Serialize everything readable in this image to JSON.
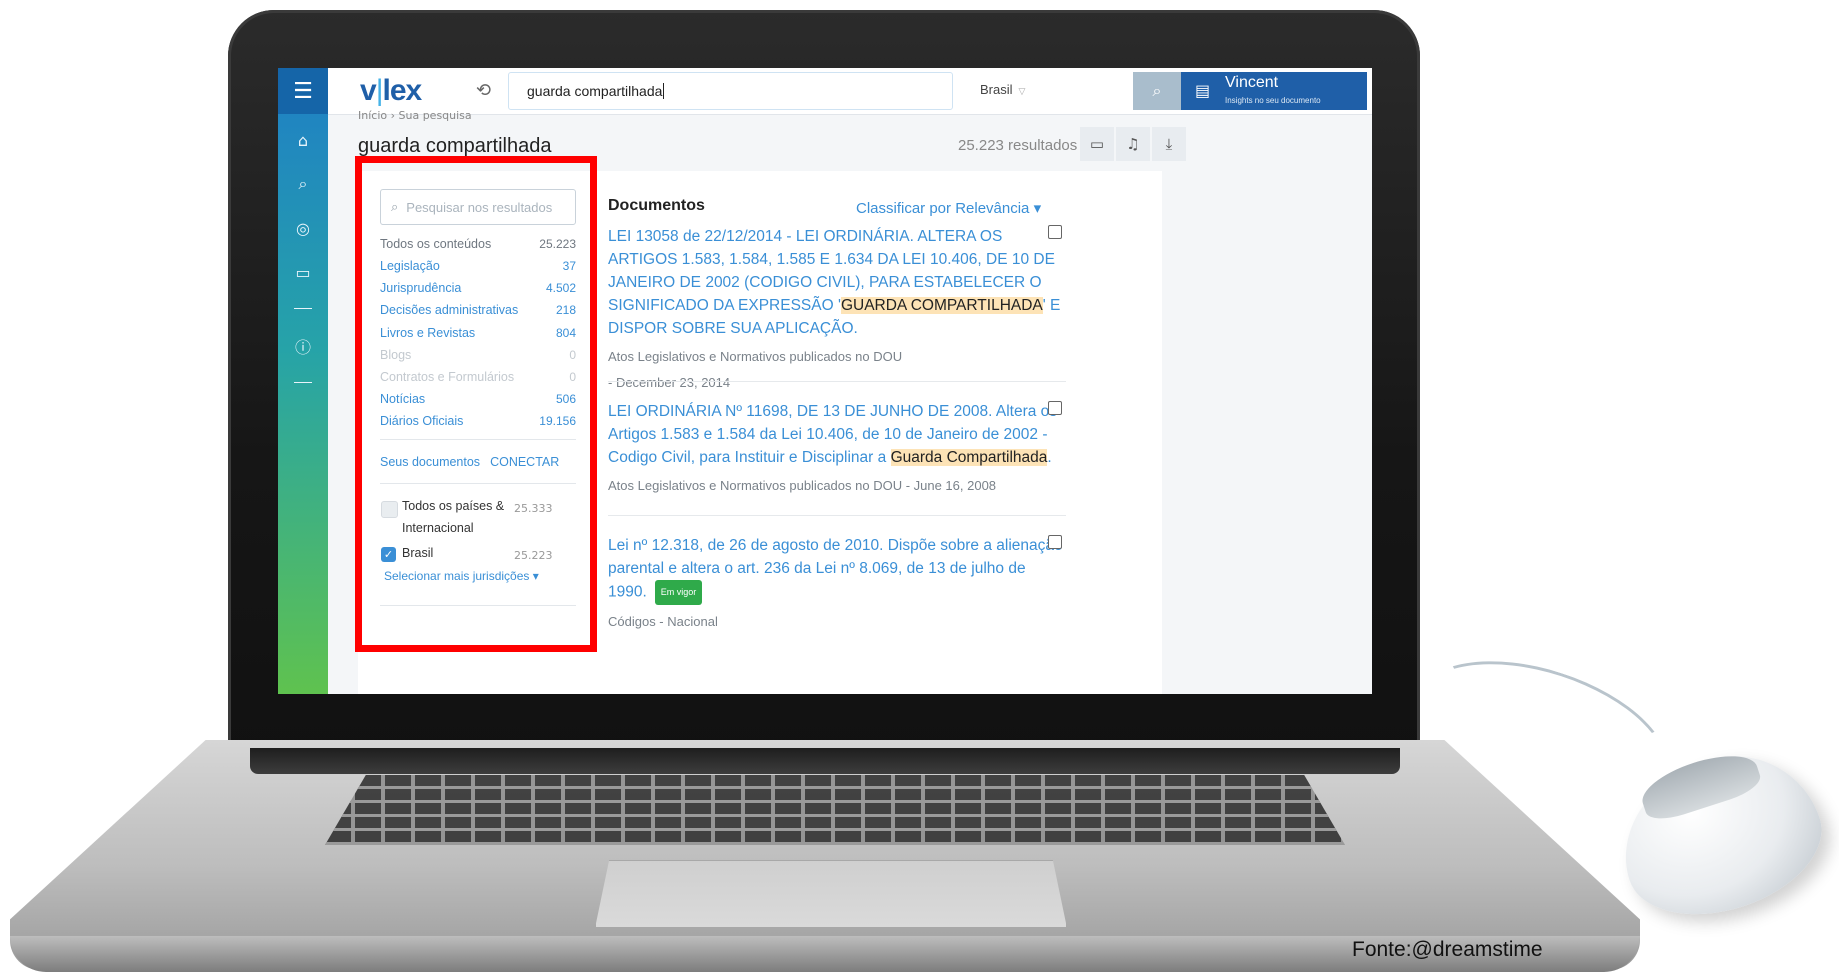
{
  "app": {
    "logo_left": "v",
    "logo_bar": "|",
    "logo_right": "lex",
    "search_query": "guarda compartilhada",
    "country": "Brasil",
    "user_name": "Vincent",
    "user_subtitle": "Insights no seu documento"
  },
  "sidebar": {
    "items": [
      {
        "name": "menu",
        "icon": "hamburger-icon",
        "glyph": "☰"
      },
      {
        "name": "home",
        "icon": "home-icon",
        "glyph": "⌂"
      },
      {
        "name": "search",
        "icon": "search-icon",
        "glyph": "⌕"
      },
      {
        "name": "explore",
        "icon": "compass-icon",
        "glyph": "◎"
      },
      {
        "name": "folders",
        "icon": "folder-icon",
        "glyph": "▭"
      },
      {
        "name": "info",
        "icon": "info-icon",
        "glyph": "ⓘ"
      }
    ]
  },
  "header": {
    "breadcrumb": "Início › Sua pesquisa",
    "page_title": "guarda compartilhada",
    "results_count": "25.223 resultados"
  },
  "filters": {
    "search_placeholder": "Pesquisar nos resultados",
    "all_label": "Todos os conteúdos",
    "all_count": "25.223",
    "categories": [
      {
        "label": "Legislação",
        "count": "37",
        "state": "link"
      },
      {
        "label": "Jurisprudência",
        "count": "4.502",
        "state": "link"
      },
      {
        "label": "Decisões administrativas",
        "count": "218",
        "state": "link"
      },
      {
        "label": "Livros e Revistas",
        "count": "804",
        "state": "link"
      },
      {
        "label": "Blogs",
        "count": "0",
        "state": "dim"
      },
      {
        "label": "Contratos e Formulários",
        "count": "0",
        "state": "dim"
      },
      {
        "label": "Notícias",
        "count": "506",
        "state": "link"
      },
      {
        "label": "Diários Oficiais",
        "count": "19.156",
        "state": "link"
      }
    ],
    "your_docs_label": "Seus documentos",
    "connect_label": "CONECTAR",
    "jurisdictions": [
      {
        "label": "Todos os países & Internacional",
        "count": "25.333",
        "checked": false
      },
      {
        "label": "Brasil",
        "count": "25.223",
        "checked": true
      }
    ],
    "more_jurisdictions": "Selecionar mais jurisdições ▾"
  },
  "documents": {
    "heading": "Documentos",
    "sort_label": "Classificar por Relevância ▾",
    "items": [
      {
        "title_before": "LEI 13058 de 22/12/2014  - LEI ORDINÁRIA. ALTERA OS ARTIGOS 1.583, 1.584, 1.585 E 1.634 DA LEI 10.406, DE 10 DE JANEIRO DE 2002 (CODIGO CIVIL), PARA ESTABELECER O SIGNIFICADO DA EXPRESSÃO '",
        "title_highlight": "GUARDA COMPARTILHADA",
        "title_after": "' E DISPOR SOBRE SUA APLICAÇÃO.",
        "meta": "Atos Legislativos e Normativos publicados no DOU - December 23, 2014",
        "badge": ""
      },
      {
        "title_before": "LEI ORDINÁRIA Nº 11698, DE 13 DE JUNHO DE 2008. Altera os Artigos 1.583 e 1.584 da Lei 10.406, de 10 de Janeiro de 2002 - Codigo Civil, para Instituir e Disciplinar a ",
        "title_highlight": "Guarda Compartilhada",
        "title_after": ".",
        "meta": "Atos Legislativos e Normativos publicados no DOU - June 16, 2008",
        "badge": ""
      },
      {
        "title_before": "Lei nº 12.318, de 26 de agosto de 2010. Dispõe sobre a alienação parental e altera o art. 236 da Lei nº 8.069, de 13 de julho de 1990.",
        "title_highlight": "",
        "title_after": "",
        "meta": "Códigos - Nacional",
        "badge": "Em vigor"
      }
    ]
  },
  "credit": "Fonte:@dreamstime",
  "colors": {
    "brand_blue": "#1f5fa8",
    "link_blue": "#3a8fd6",
    "highlight": "#fde3b6",
    "annotation_red": "#ff0000",
    "badge_green": "#2faa4a"
  }
}
